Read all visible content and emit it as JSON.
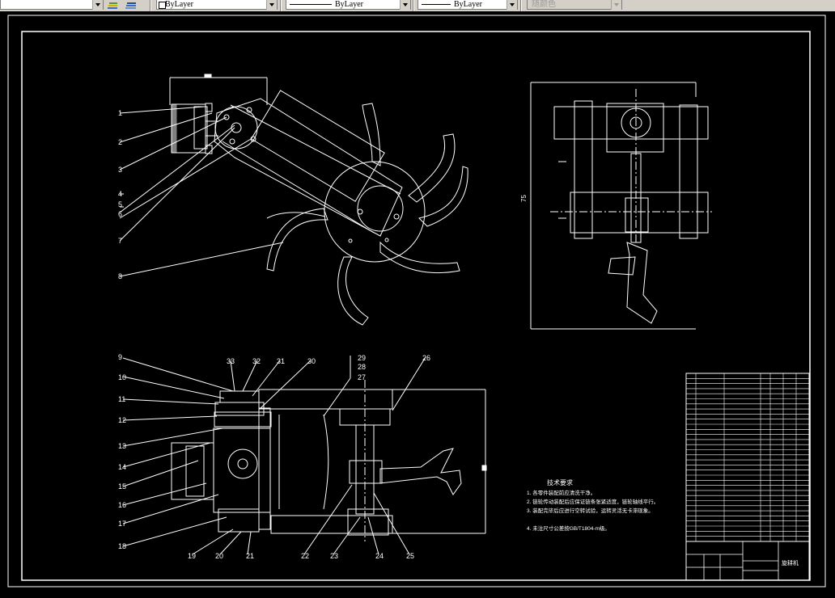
{
  "toolbar": {
    "color_combo": "ByLayer",
    "linetype_combo": "ByLayer",
    "lineweight_combo": "ByLayer",
    "plotstyle_combo": "随颜色"
  },
  "drawing": {
    "background": "#000000",
    "line_color": "#ffffff",
    "leader_numbers_top": [
      "1",
      "2",
      "3",
      "4",
      "5",
      "6",
      "7",
      "8"
    ],
    "leader_numbers_bottom_left": [
      "9",
      "10",
      "11",
      "12",
      "13",
      "14",
      "15",
      "16",
      "17",
      "18",
      "19",
      "20",
      "21"
    ],
    "leader_numbers_bottom_right": [
      "33",
      "32",
      "31",
      "30",
      "29",
      "28",
      "27",
      "26",
      "22",
      "23",
      "24",
      "25"
    ],
    "dim_side_view": "75",
    "tech_req_title": "技术要求",
    "tech_req_lines": [
      "1. 各零件装配前应清洗干净。",
      "2. 链轮传动装配后应保证链条张紧适度，链轮轴线平行。",
      "3. 装配完毕后应进行空转试验，运转灵活无卡滞现象。",
      "4. 未注尺寸公差按GB/T1804-m级。"
    ],
    "title_block_name": "旋耕机"
  }
}
